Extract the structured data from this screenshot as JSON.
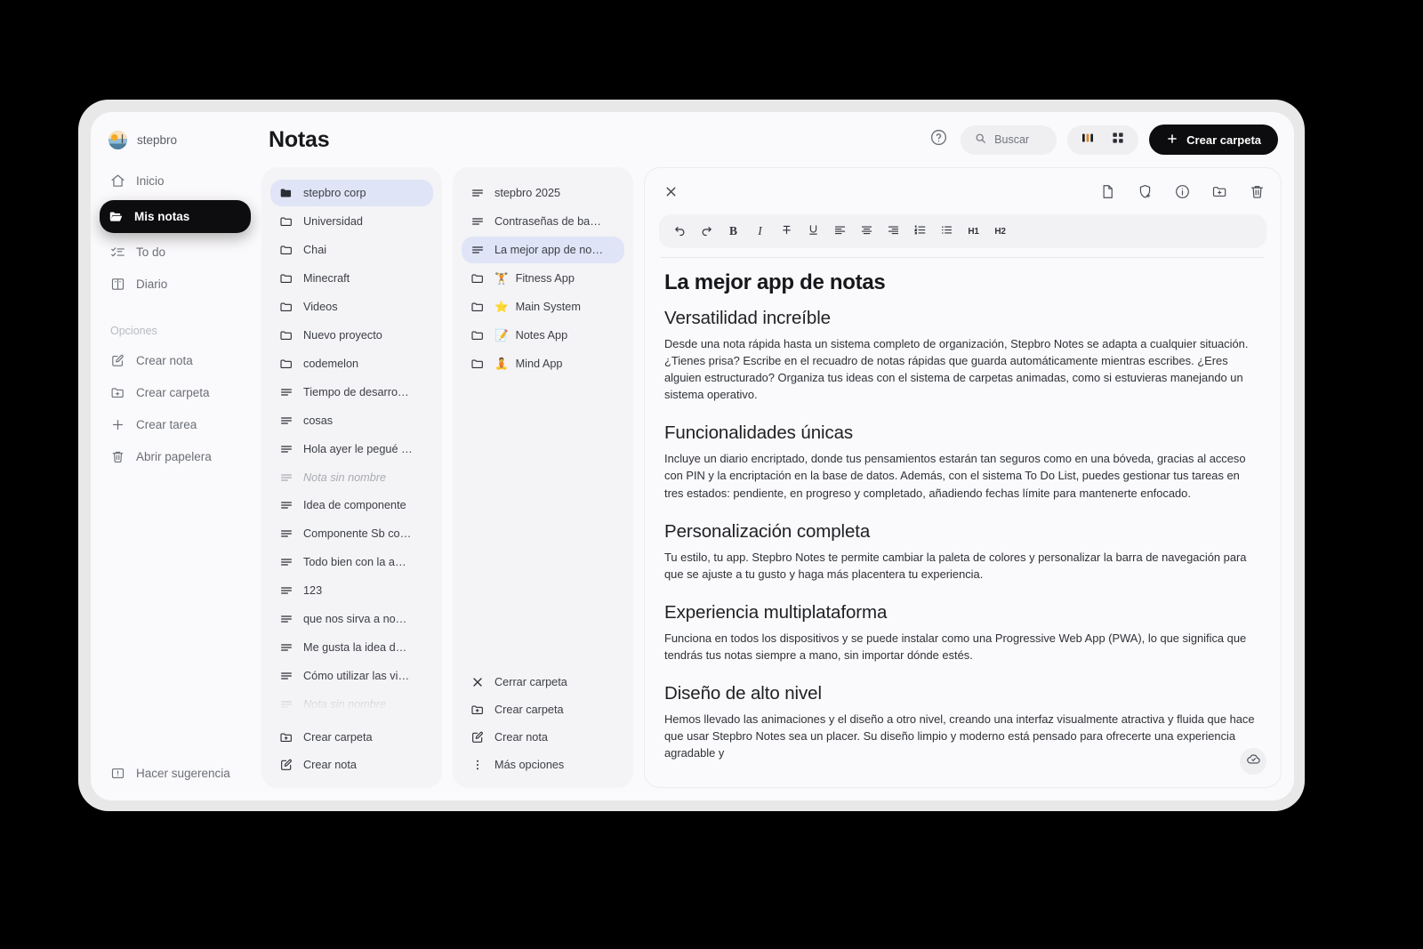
{
  "sidebar": {
    "user": {
      "name": "stepbro",
      "avatar_icon": "avatar-landscape"
    },
    "nav": [
      {
        "label": "Inicio",
        "icon": "home-icon",
        "active": false
      },
      {
        "label": "Mis notas",
        "icon": "folder-open-icon",
        "active": true
      },
      {
        "label": "To do",
        "icon": "checklist-icon",
        "active": false
      },
      {
        "label": "Diario",
        "icon": "book-icon",
        "active": false
      }
    ],
    "options_label": "Opciones",
    "options": [
      {
        "label": "Crear nota",
        "icon": "edit-square-icon"
      },
      {
        "label": "Crear carpeta",
        "icon": "folder-plus-icon"
      },
      {
        "label": "Crear tarea",
        "icon": "plus-icon"
      },
      {
        "label": "Abrir papelera",
        "icon": "trash-icon"
      }
    ],
    "footer": {
      "label": "Hacer sugerencia",
      "icon": "feedback-icon"
    }
  },
  "header": {
    "title": "Notas",
    "help_icon": "help-circle-icon",
    "search": {
      "placeholder": "Buscar",
      "icon": "search-icon"
    },
    "view_modes": [
      {
        "name": "columns-view",
        "icon": "columns-icon",
        "active": true
      },
      {
        "name": "grid-view",
        "icon": "grid-icon",
        "active": false
      }
    ],
    "create_folder_button": {
      "label": "Crear carpeta",
      "icon": "plus-icon"
    }
  },
  "columns": [
    {
      "name": "column-root",
      "items": [
        {
          "label": "stepbro corp",
          "type": "folder",
          "selected": true,
          "filled": true
        },
        {
          "label": "Universidad",
          "type": "folder"
        },
        {
          "label": "Chai",
          "type": "folder"
        },
        {
          "label": "Minecraft",
          "type": "folder"
        },
        {
          "label": "Videos",
          "type": "folder"
        },
        {
          "label": "Nuevo proyecto",
          "type": "folder"
        },
        {
          "label": "codemelon",
          "type": "folder"
        },
        {
          "label": "Tiempo de desarro…",
          "type": "note"
        },
        {
          "label": "cosas",
          "type": "note"
        },
        {
          "label": "Hola ayer le pegué …",
          "type": "note"
        },
        {
          "label": "Nota sin nombre",
          "type": "note",
          "unnamed": true
        },
        {
          "label": "Idea de componente",
          "type": "note"
        },
        {
          "label": "Componente Sb co…",
          "type": "note"
        },
        {
          "label": "Todo bien con la a…",
          "type": "note"
        },
        {
          "label": "123",
          "type": "note"
        },
        {
          "label": "que nos sirva a no…",
          "type": "note"
        },
        {
          "label": "Me gusta la idea d…",
          "type": "note"
        },
        {
          "label": "Cómo utilizar las vi…",
          "type": "note"
        },
        {
          "label": "Nota sin nombre",
          "type": "note",
          "unnamed": true
        }
      ],
      "actions": [
        {
          "label": "Crear carpeta",
          "icon": "folder-plus-icon"
        },
        {
          "label": "Crear nota",
          "icon": "edit-square-icon"
        }
      ]
    },
    {
      "name": "column-stepbro-corp",
      "items": [
        {
          "label": "stepbro 2025",
          "type": "note"
        },
        {
          "label": "Contraseñas de ba…",
          "type": "note"
        },
        {
          "label": "La mejor app de no…",
          "type": "note",
          "selected": true
        },
        {
          "label": "Fitness App",
          "type": "folder",
          "emoji": "🏋"
        },
        {
          "label": "Main System",
          "type": "folder",
          "emoji": "⭐"
        },
        {
          "label": "Notes App",
          "type": "folder",
          "emoji": "📝"
        },
        {
          "label": "Mind App",
          "type": "folder",
          "emoji": "🧘"
        }
      ],
      "actions": [
        {
          "label": "Cerrar carpeta",
          "icon": "close-icon"
        },
        {
          "label": "Crear carpeta",
          "icon": "folder-plus-icon"
        },
        {
          "label": "Crear nota",
          "icon": "edit-square-icon"
        },
        {
          "label": "Más opciones",
          "icon": "more-vertical-icon"
        }
      ]
    }
  ],
  "editor": {
    "close_icon": "close-icon",
    "top_icons": [
      {
        "name": "page-icon",
        "label": "Página"
      },
      {
        "name": "shield-plus-icon",
        "label": "Proteger"
      },
      {
        "name": "info-circle-icon",
        "label": "Información"
      },
      {
        "name": "folder-move-icon",
        "label": "Mover a carpeta"
      },
      {
        "name": "trash-icon",
        "label": "Eliminar"
      }
    ],
    "format_buttons": [
      {
        "name": "undo-icon",
        "glyph": "↺"
      },
      {
        "name": "redo-icon",
        "glyph": "↻"
      },
      {
        "name": "bold-icon",
        "glyph": "B"
      },
      {
        "name": "italic-icon",
        "glyph": "I"
      },
      {
        "name": "strikethrough-icon",
        "glyph": "S"
      },
      {
        "name": "underline-icon",
        "glyph": "U"
      },
      {
        "name": "align-left-icon",
        "glyph": ""
      },
      {
        "name": "align-center-icon",
        "glyph": ""
      },
      {
        "name": "align-right-icon",
        "glyph": ""
      },
      {
        "name": "ordered-list-icon",
        "glyph": ""
      },
      {
        "name": "bullet-list-icon",
        "glyph": ""
      },
      {
        "name": "heading-1-icon",
        "glyph": "H1"
      },
      {
        "name": "heading-2-icon",
        "glyph": "H2"
      }
    ],
    "document": {
      "title": "La mejor app de notas",
      "sections": [
        {
          "heading": "Versatilidad increíble",
          "body": "Desde una nota rápida hasta un sistema completo de organización, Stepbro Notes se adapta a cualquier situación. ¿Tienes prisa? Escribe en el recuadro de notas rápidas que guarda automáticamente mientras escribes. ¿Eres alguien estructurado? Organiza tus ideas con el sistema de carpetas animadas, como si estuvieras manejando un sistema operativo."
        },
        {
          "heading": "Funcionalidades únicas",
          "body": "Incluye un diario encriptado, donde tus pensamientos estarán tan seguros como en una bóveda, gracias al acceso con PIN y la encriptación en la base de datos. Además, con el sistema To Do List, puedes gestionar tus tareas en tres estados: pendiente, en progreso y completado, añadiendo fechas límite para mantenerte enfocado."
        },
        {
          "heading": "Personalización completa",
          "body": "Tu estilo, tu app. Stepbro Notes te permite cambiar la paleta de colores y personalizar la barra de navegación para que se ajuste a tu gusto y haga más placentera tu experiencia."
        },
        {
          "heading": "Experiencia multiplataforma",
          "body": "Funciona en todos los dispositivos y se puede instalar como una Progressive Web App (PWA), lo que significa que tendrás tus notas siempre a mano, sin importar dónde estés."
        },
        {
          "heading": "Diseño de alto nivel",
          "body": "Hemos llevado las animaciones y el diseño a otro nivel, creando una interfaz visualmente atractiva y fluida que hace que usar Stepbro Notes sea un placer. Su diseño limpio y moderno está pensado para ofrecerte una experiencia agradable y"
        }
      ]
    },
    "sync_badge": {
      "icon": "cloud-check-icon"
    }
  },
  "colors": {
    "page_background": "#000000",
    "app_background": "#faf9fb",
    "panel_background": "#f4f3f6",
    "selection_blue": "#dfe5f7",
    "accent_dark": "#0d0d0f",
    "active_orange": "#e8821f"
  }
}
